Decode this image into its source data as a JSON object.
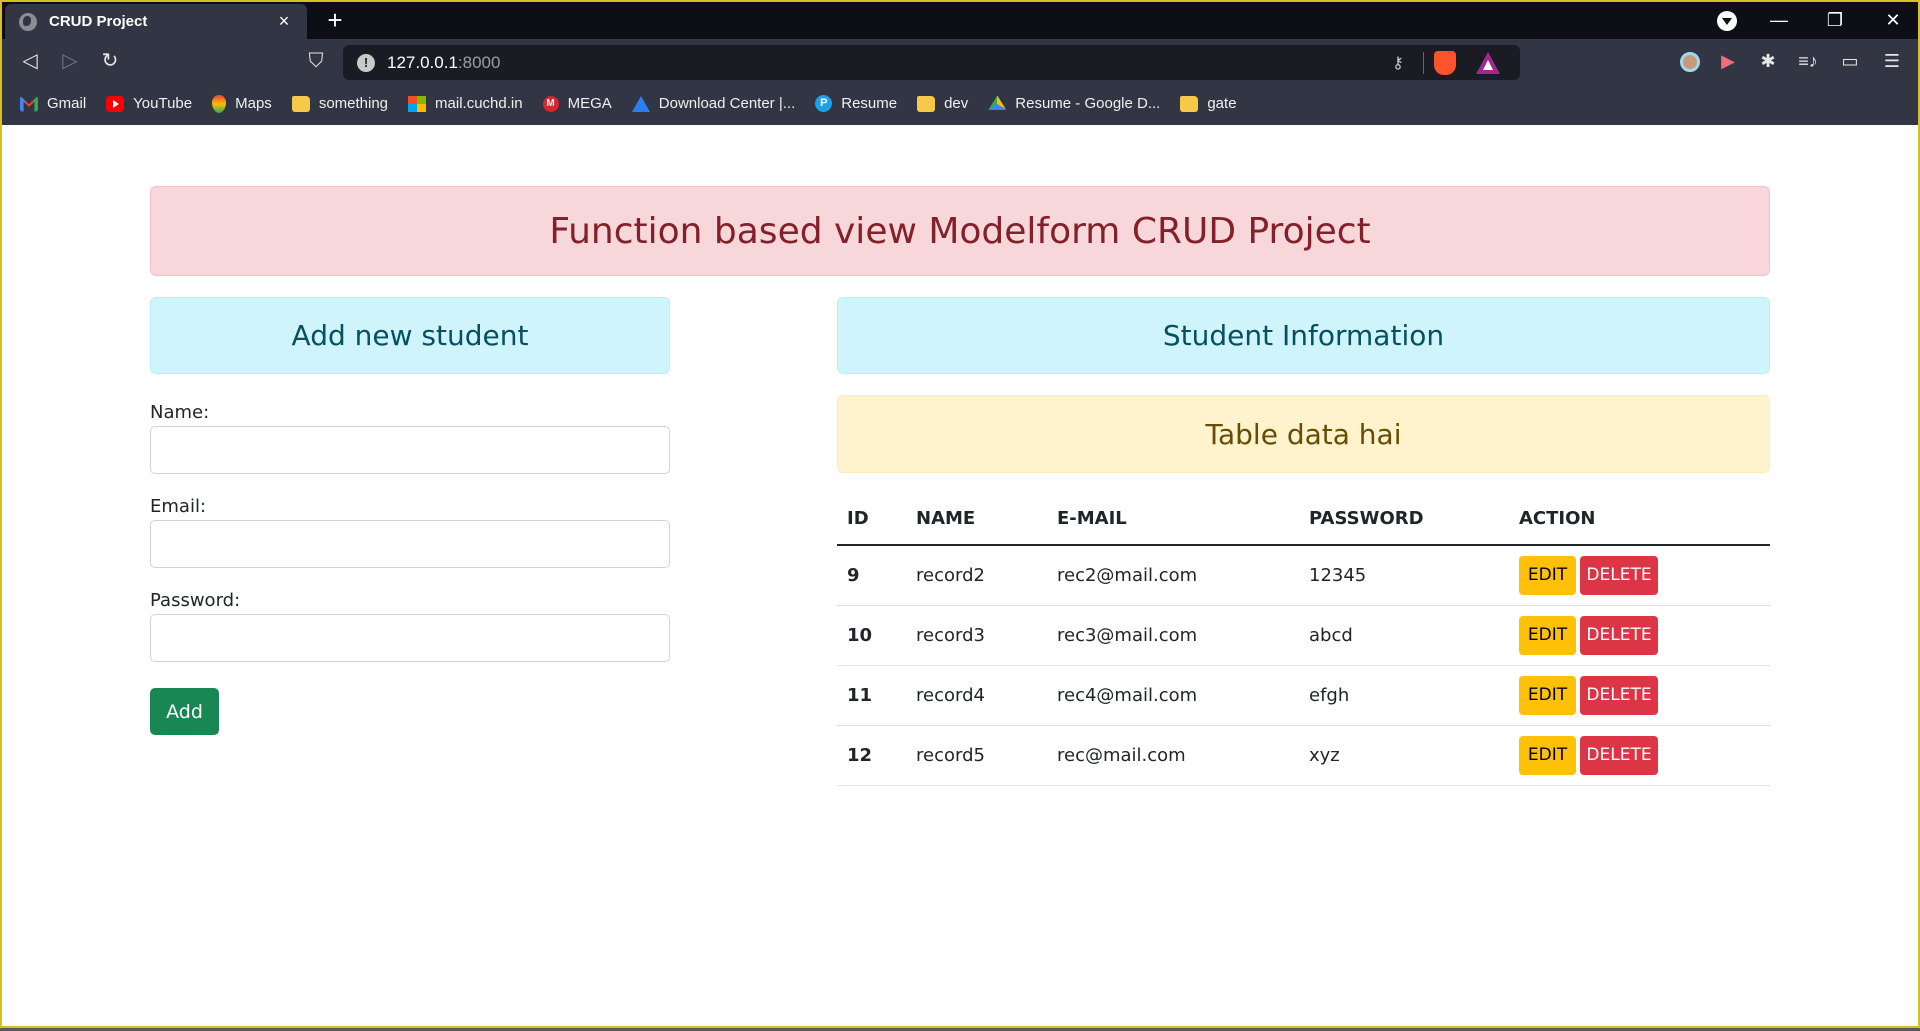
{
  "browser": {
    "tab_title": "CRUD Project",
    "tab_close": "×",
    "new_tab": "+",
    "url_host": "127.0.0.1",
    "url_port": ":8000",
    "controls": {
      "minimize": "—",
      "maximize": "❐",
      "close": "✕"
    },
    "icons": {
      "back": "◁",
      "forward": "▷",
      "reload": "↻",
      "bookmark": "⛉",
      "info": "!",
      "key": "⚷",
      "puzzle": "✱",
      "media": "≡♪",
      "wallet": "▭",
      "menu": "☰",
      "record": "▶"
    }
  },
  "bookmarks": [
    {
      "label": "Gmail",
      "icon": "gmail"
    },
    {
      "label": "YouTube",
      "icon": "youtube"
    },
    {
      "label": "Maps",
      "icon": "maps"
    },
    {
      "label": "something",
      "icon": "folder"
    },
    {
      "label": "mail.cuchd.in",
      "icon": "ms"
    },
    {
      "label": "MEGA",
      "icon": "mega"
    },
    {
      "label": "Download Center |...",
      "icon": "dl"
    },
    {
      "label": "Resume",
      "icon": "p"
    },
    {
      "label": "dev",
      "icon": "folder"
    },
    {
      "label": "Resume - Google D...",
      "icon": "drive"
    },
    {
      "label": "gate",
      "icon": "folder"
    }
  ],
  "page": {
    "title": "Function based view Modelform CRUD Project",
    "form": {
      "heading": "Add new student",
      "name_label": "Name:",
      "name_value": "",
      "email_label": "Email:",
      "email_value": "",
      "password_label": "Password:",
      "password_value": "",
      "submit_label": "Add"
    },
    "info": {
      "heading": "Student Information",
      "subheading": "Table data hai",
      "columns": [
        "ID",
        "NAME",
        "E-MAIL",
        "PASSWORD",
        "ACTION"
      ],
      "edit_label": "EDIT",
      "delete_label": "DELETE",
      "rows": [
        {
          "id": "9",
          "name": "record2",
          "email": "rec2@mail.com",
          "password": "12345"
        },
        {
          "id": "10",
          "name": "record3",
          "email": "rec3@mail.com",
          "password": "abcd"
        },
        {
          "id": "11",
          "name": "record4",
          "email": "rec4@mail.com",
          "password": "efgh"
        },
        {
          "id": "12",
          "name": "record5",
          "email": "rec@mail.com",
          "password": "xyz"
        }
      ]
    }
  },
  "colors": {
    "danger_bg": "#f8d7da",
    "danger_text": "#842029",
    "info_bg": "#cff4fc",
    "info_text": "#055160",
    "warning_bg": "#fff3cd",
    "warning_text": "#664d03",
    "success": "#198754",
    "edit": "#ffc107",
    "delete": "#dc3545"
  }
}
